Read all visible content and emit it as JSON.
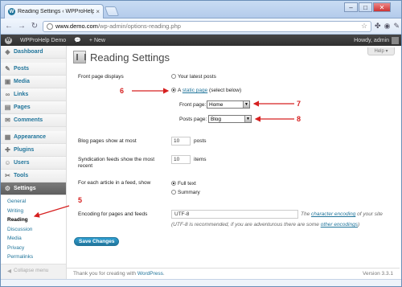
{
  "browser": {
    "tab_title": "Reading Settings ‹ WPProHelp",
    "url_domain": "www.demo.com",
    "url_path": "/wp-admin/options-reading.php",
    "controls": {
      "minimize": "–",
      "maximize": "□",
      "close": "✕"
    }
  },
  "adminbar": {
    "site_name": "WPProHelp Demo",
    "new_label": "+ New",
    "greeting": "Howdy, admin"
  },
  "sidebar": {
    "items": [
      {
        "label": "Dashboard",
        "icon": "dashboard-icon",
        "glyph": "◈"
      },
      {
        "label": "Posts",
        "icon": "pushpin-icon",
        "glyph": "✎"
      },
      {
        "label": "Media",
        "icon": "media-icon",
        "glyph": "▣"
      },
      {
        "label": "Links",
        "icon": "link-icon",
        "glyph": "∞"
      },
      {
        "label": "Pages",
        "icon": "page-icon",
        "glyph": "▤"
      },
      {
        "label": "Comments",
        "icon": "comment-icon",
        "glyph": "✉"
      },
      {
        "label": "Appearance",
        "icon": "appearance-icon",
        "glyph": "▦"
      },
      {
        "label": "Plugins",
        "icon": "plugin-icon",
        "glyph": "✚"
      },
      {
        "label": "Users",
        "icon": "users-icon",
        "glyph": "☺"
      },
      {
        "label": "Tools",
        "icon": "tools-icon",
        "glyph": "✂"
      },
      {
        "label": "Settings",
        "icon": "settings-icon",
        "glyph": "⚙"
      }
    ],
    "settings_sub": [
      "General",
      "Writing",
      "Reading",
      "Discussion",
      "Media",
      "Privacy",
      "Permalinks"
    ],
    "active_sub": "Reading",
    "collapse_label": "Collapse menu"
  },
  "page": {
    "help_label": "Help ▾",
    "title": "Reading Settings",
    "front_page_displays": {
      "label": "Front page displays",
      "option_latest": "Your latest posts",
      "option_static_prefix": "A",
      "option_static_link": "static page",
      "option_static_suffix": "(select below)",
      "selected": "static page",
      "front_page_label": "Front page:",
      "front_page_value": "Home",
      "posts_page_label": "Posts page:",
      "posts_page_value": "Blog"
    },
    "blog_pages": {
      "label": "Blog pages show at most",
      "value": "10",
      "unit": "posts"
    },
    "syndication": {
      "label": "Syndication feeds show the most recent",
      "value": "10",
      "unit": "items"
    },
    "feed_article": {
      "label": "For each article in a feed, show",
      "option_full": "Full text",
      "option_summary": "Summary",
      "selected": "Full text"
    },
    "encoding": {
      "label": "Encoding for pages and feeds",
      "value": "UTF-8",
      "desc_prefix": "The",
      "desc_link": "character encoding",
      "desc_suffix": "of your site",
      "note_prefix": "(UTF-8 is recommended, if you are adventurous there are some",
      "note_link": "other encodings",
      "note_suffix": ")"
    },
    "save_label": "Save Changes",
    "footer_text_prefix": "Thank you for creating with",
    "footer_link": "WordPress",
    "footer_suffix": ".",
    "version": "Version 3.3.1"
  },
  "annotations": [
    "5",
    "6",
    "7",
    "8"
  ],
  "colors": {
    "annotation": "#d62020",
    "link": "#21759b",
    "adminbar": "#464646"
  }
}
